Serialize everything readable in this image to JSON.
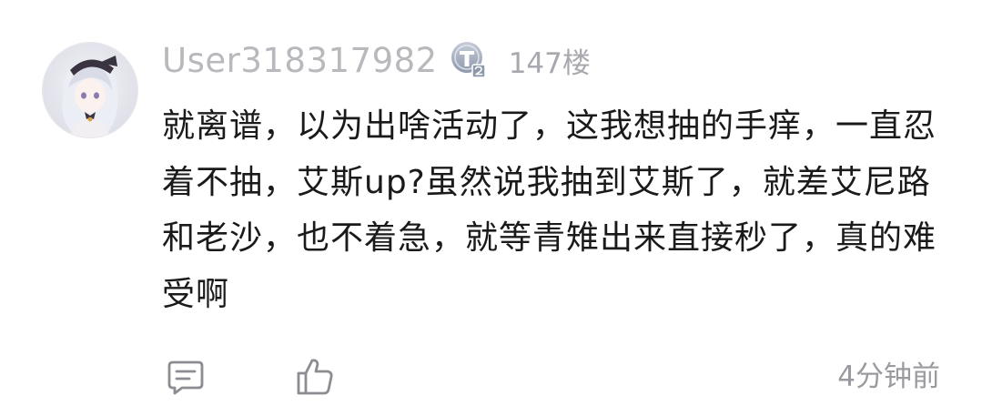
{
  "comment": {
    "username": "User318317982",
    "level_badge": "T2",
    "floor": "147楼",
    "text": "就离谱，以为出啥活动了，这我想抽的手痒，一直忍着不抽，艾斯up?虽然说我抽到艾斯了，就差艾尼路和老沙，也不着急，就等青雉出来直接秒了，真的难受啊",
    "time": "4分钟前"
  },
  "icons": {
    "reply": "reply-comment-icon",
    "like": "thumbs-up-icon"
  },
  "colors": {
    "username": "#b8b8bd",
    "text": "#1a1a1a",
    "muted": "#9a9aa0",
    "badge": "#9aa4b6"
  }
}
